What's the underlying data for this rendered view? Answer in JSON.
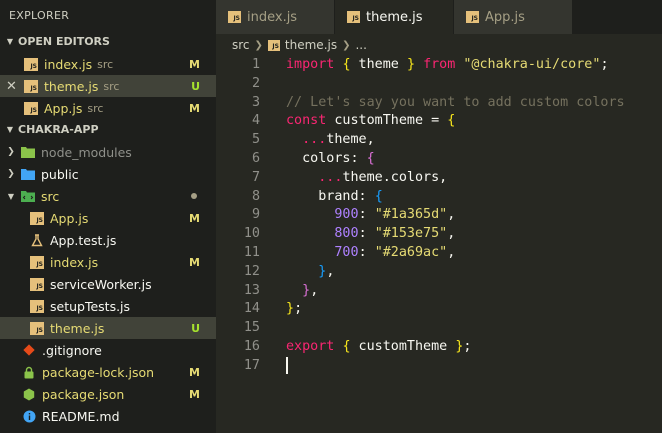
{
  "explorer": {
    "title": "EXPLORER",
    "open_editors": {
      "label": "OPEN EDITORS",
      "items": [
        {
          "name": "index.js",
          "desc": "src",
          "badge": "M"
        },
        {
          "name": "theme.js",
          "desc": "src",
          "badge": "U"
        },
        {
          "name": "App.js",
          "desc": "src",
          "badge": "M"
        }
      ]
    },
    "project": {
      "label": "CHAKRA-APP",
      "node_modules": "node_modules",
      "public": "public",
      "src": "src",
      "src_files": [
        {
          "name": "App.js",
          "badge": "M"
        },
        {
          "name": "App.test.js",
          "badge": ""
        },
        {
          "name": "index.js",
          "badge": "M"
        },
        {
          "name": "serviceWorker.js",
          "badge": ""
        },
        {
          "name": "setupTests.js",
          "badge": ""
        },
        {
          "name": "theme.js",
          "badge": "U"
        }
      ],
      "root_files": [
        {
          "name": ".gitignore",
          "badge": ""
        },
        {
          "name": "package-lock.json",
          "badge": "M"
        },
        {
          "name": "package.json",
          "badge": "M"
        },
        {
          "name": "README.md",
          "badge": ""
        }
      ]
    }
  },
  "tabs": [
    {
      "label": "index.js"
    },
    {
      "label": "theme.js"
    },
    {
      "label": "App.js"
    }
  ],
  "breadcrumb": {
    "folder": "src",
    "file": "theme.js",
    "more": "..."
  },
  "editor": {
    "line_numbers": [
      "1",
      "2",
      "3",
      "4",
      "5",
      "6",
      "7",
      "8",
      "9",
      "10",
      "11",
      "12",
      "13",
      "14",
      "15",
      "16",
      "17"
    ],
    "l1": {
      "kw": "import",
      "ob": "{",
      "name": " theme ",
      "cb": "}",
      "from": "from",
      "str": "\"@chakra-ui/core\"",
      "end": ";"
    },
    "l3": "// Let's say you want to add custom colors",
    "l4": {
      "kw": "const",
      "name": " customTheme = ",
      "ob": "{"
    },
    "l5": {
      "spread": "...",
      "name": "theme,"
    },
    "l6": {
      "name": "colors: ",
      "ob": "{"
    },
    "l7": {
      "spread": "...",
      "name": "theme.colors,"
    },
    "l8": {
      "name": "brand: ",
      "ob": "{"
    },
    "l9": {
      "num": "900",
      "colon": ": ",
      "str": "\"#1a365d\"",
      "comma": ","
    },
    "l10": {
      "num": "800",
      "colon": ": ",
      "str": "\"#153e75\"",
      "comma": ","
    },
    "l11": {
      "num": "700",
      "colon": ": ",
      "str": "\"#2a69ac\"",
      "comma": ","
    },
    "l12": {
      "cb": "}",
      "comma": ","
    },
    "l13": {
      "cb": "}",
      "comma": ","
    },
    "l14": {
      "cb": "}",
      "end": ";"
    },
    "l16": {
      "kw": "export",
      "ob": "{",
      "name": " customTheme ",
      "cb": "}",
      "end": ";"
    }
  }
}
